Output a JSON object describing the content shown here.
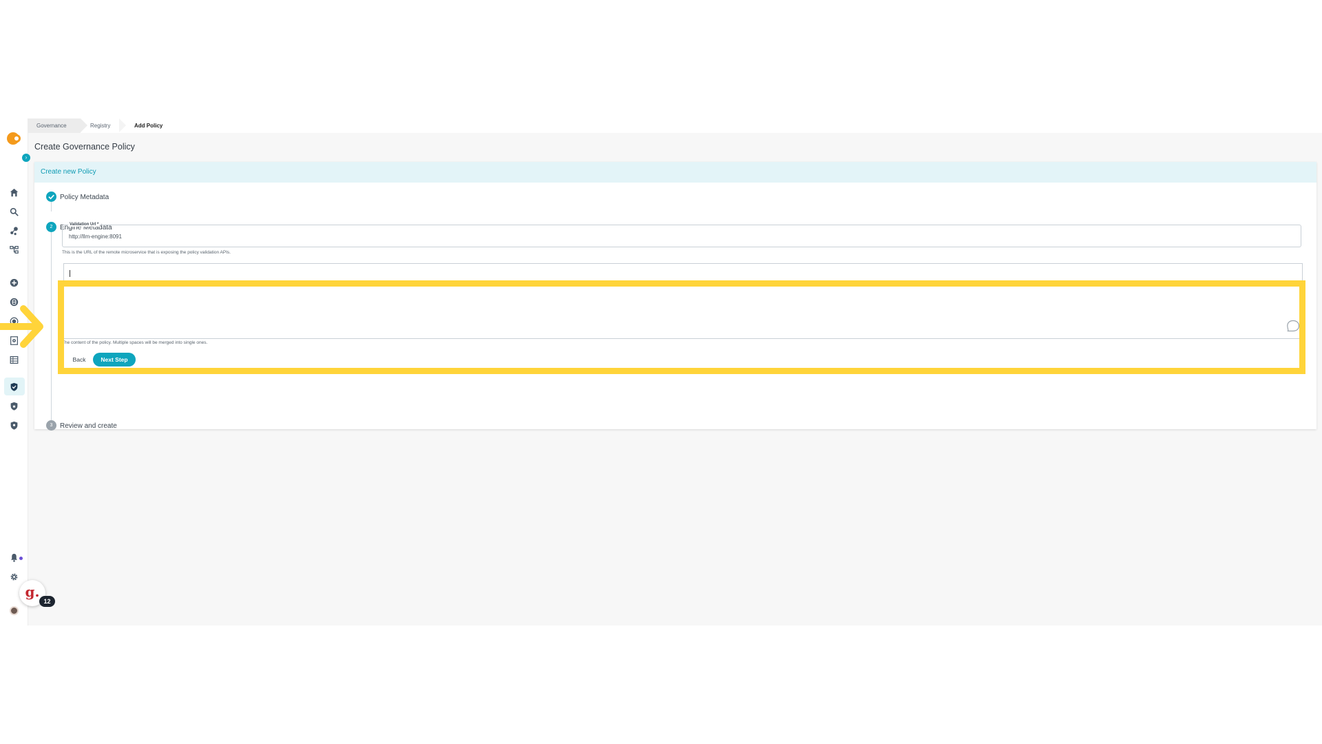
{
  "breadcrumb": {
    "items": [
      "Governance",
      "Registry",
      "Add Policy"
    ]
  },
  "page": {
    "title": "Create Governance Policy"
  },
  "card": {
    "header": "Create new Policy"
  },
  "steps": [
    {
      "label": "Policy Metadata",
      "status": "done",
      "number": "1"
    },
    {
      "label": "Engine Metadata",
      "status": "active",
      "number": "2"
    },
    {
      "label": "Review and create",
      "status": "todo",
      "number": "3"
    }
  ],
  "validation_url": {
    "label": "Validation Url *",
    "value": "http://llm-engine:8091",
    "help": "This is the URL of the remote microservice that is exposing the policy validation APIs."
  },
  "content": {
    "value": "",
    "help": "The content of the policy. Multiple spaces will be merged into single ones."
  },
  "buttons": {
    "back": "Back",
    "next": "Next Step"
  },
  "grammarly": {
    "badge": "12",
    "glyph": "g."
  },
  "colors": {
    "accent": "#0ea5bd",
    "highlight": "#ffd43a",
    "header_bg": "#e3f4f8",
    "logo": "#f49a1c"
  },
  "icons": {
    "sidebar": [
      "home-icon",
      "search-icon",
      "share-nodes-icon",
      "lineage-icon",
      "add-circle-icon",
      "database-icon",
      "target-icon",
      "document-gear-icon",
      "table-icon",
      "shield-check-icon",
      "shield-lock-icon",
      "shield-key-icon",
      "bell-icon",
      "gear-icon",
      "avatar"
    ]
  }
}
